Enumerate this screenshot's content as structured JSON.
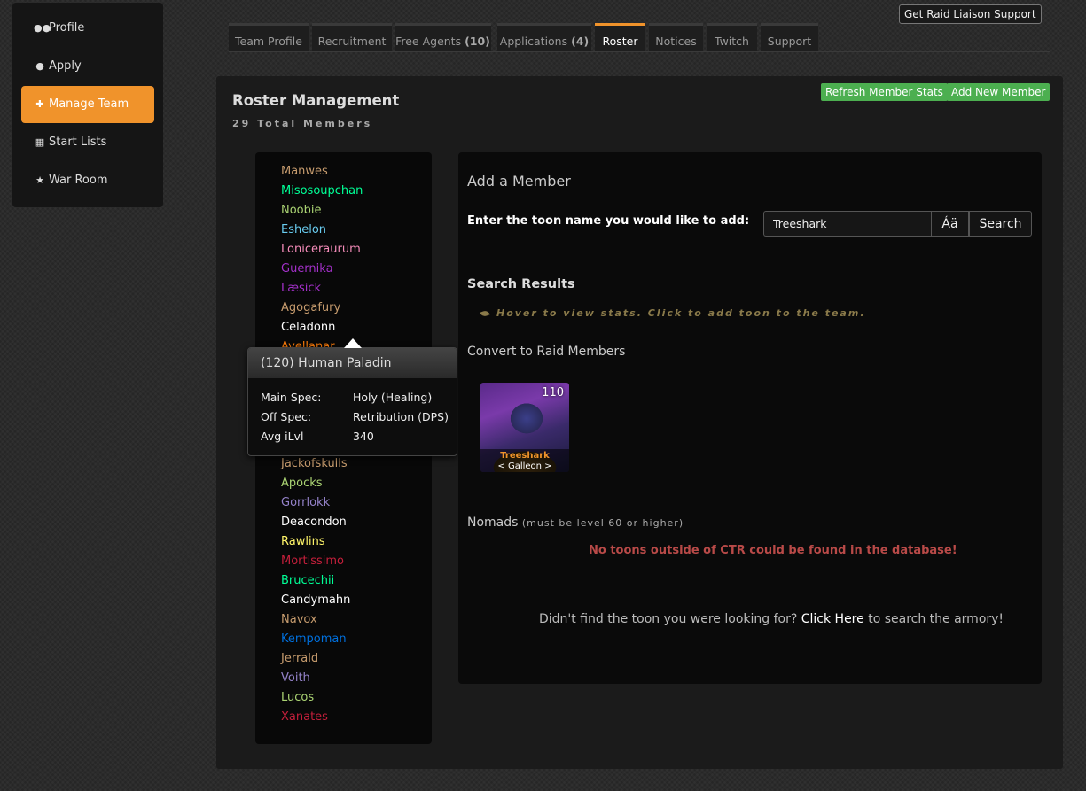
{
  "sidebar": {
    "items": [
      {
        "label": "Profile",
        "icon": "users-icon",
        "glyph": "👥",
        "active": false
      },
      {
        "label": "Apply",
        "icon": "user-icon",
        "glyph": "👤",
        "active": false
      },
      {
        "label": "Manage Team",
        "icon": "puzzle-icon",
        "glyph": "✚",
        "active": true
      },
      {
        "label": "Start Lists",
        "icon": "table-icon",
        "glyph": "▦",
        "active": false
      },
      {
        "label": "War Room",
        "icon": "trophy-icon",
        "glyph": "🏆",
        "active": false
      }
    ]
  },
  "support_button": "Get Raid Liaison Support",
  "tabs": [
    {
      "label": "Team Profile",
      "count": ""
    },
    {
      "label": "Recruitment",
      "count": ""
    },
    {
      "label": "Free Agents",
      "count": "(10)"
    },
    {
      "label": "Applications",
      "count": "(4)"
    },
    {
      "label": "Roster",
      "count": "",
      "active": true
    },
    {
      "label": "Notices",
      "count": ""
    },
    {
      "label": "Twitch",
      "count": ""
    },
    {
      "label": "Support",
      "count": ""
    }
  ],
  "panel": {
    "title": "Roster Management",
    "subtitle": "29 Total Members",
    "refresh_button": "Refresh Member Stats",
    "add_button": "Add New Member"
  },
  "colors": {
    "accent": "#f0932b",
    "green": "#4caf50",
    "error": "#b94a48"
  },
  "roster": [
    {
      "name": "Manwes",
      "color": "#c79c6e"
    },
    {
      "name": "Misosoupchan",
      "color": "#00ff96"
    },
    {
      "name": "Noobie",
      "color": "#abd473"
    },
    {
      "name": "Eshelon",
      "color": "#69ccf0"
    },
    {
      "name": "Loniceraurum",
      "color": "#f58cba"
    },
    {
      "name": "Guernika",
      "color": "#a330c9"
    },
    {
      "name": "Læsick",
      "color": "#a330c9"
    },
    {
      "name": "Agogafury",
      "color": "#c79c6e"
    },
    {
      "name": "Celadonn",
      "color": "#ffffff"
    },
    {
      "name": "Avellanar",
      "color": "#ff7d0a"
    },
    {
      "name": "Jackofskulls",
      "color": "#c79c6e"
    },
    {
      "name": "Apocks",
      "color": "#abd473"
    },
    {
      "name": "Gorrlokk",
      "color": "#9482c9"
    },
    {
      "name": "Deacondon",
      "color": "#ffffff"
    },
    {
      "name": "Rawlins",
      "color": "#fff569"
    },
    {
      "name": "Mortissimo",
      "color": "#c41f3b"
    },
    {
      "name": "Brucechii",
      "color": "#00ff96"
    },
    {
      "name": "Candymahn",
      "color": "#ffffff"
    },
    {
      "name": "Navox",
      "color": "#c79c6e"
    },
    {
      "name": "Kempoman",
      "color": "#0070de"
    },
    {
      "name": "Jerrald",
      "color": "#c79c6e"
    },
    {
      "name": "Voith",
      "color": "#9482c9"
    },
    {
      "name": "Lucos",
      "color": "#abd473"
    },
    {
      "name": "Xanates",
      "color": "#c41f3b"
    }
  ],
  "tooltip": {
    "header": "(120) Human Paladin",
    "rows": [
      {
        "label": "Main Spec:",
        "value": "Holy (Healing)"
      },
      {
        "label": "Off Spec:",
        "value": "Retribution (DPS)"
      },
      {
        "label": "Avg iLvl",
        "value": "340"
      }
    ]
  },
  "add_member": {
    "heading": "Add a Member",
    "prompt": "Enter the toon name you would like to add:",
    "input_value": "Treeshark",
    "accent_button": "Áä",
    "search_button": "Search"
  },
  "search_results": {
    "heading": "Search Results",
    "hint": "Hover to view stats. Click to add toon to the team.",
    "convert_heading": "Convert to Raid Members",
    "toon": {
      "level": "110",
      "name": "Treeshark",
      "guild": "< Galleon >"
    },
    "nomads_heading": "Nomads",
    "nomads_note": "(must be level 60 or higher)",
    "error": "No toons outside of CTR could be found in the database!",
    "armory_pre": "Didn't find the toon you were looking for?",
    "armory_link": "Click Here",
    "armory_post": "to search the armory!"
  }
}
